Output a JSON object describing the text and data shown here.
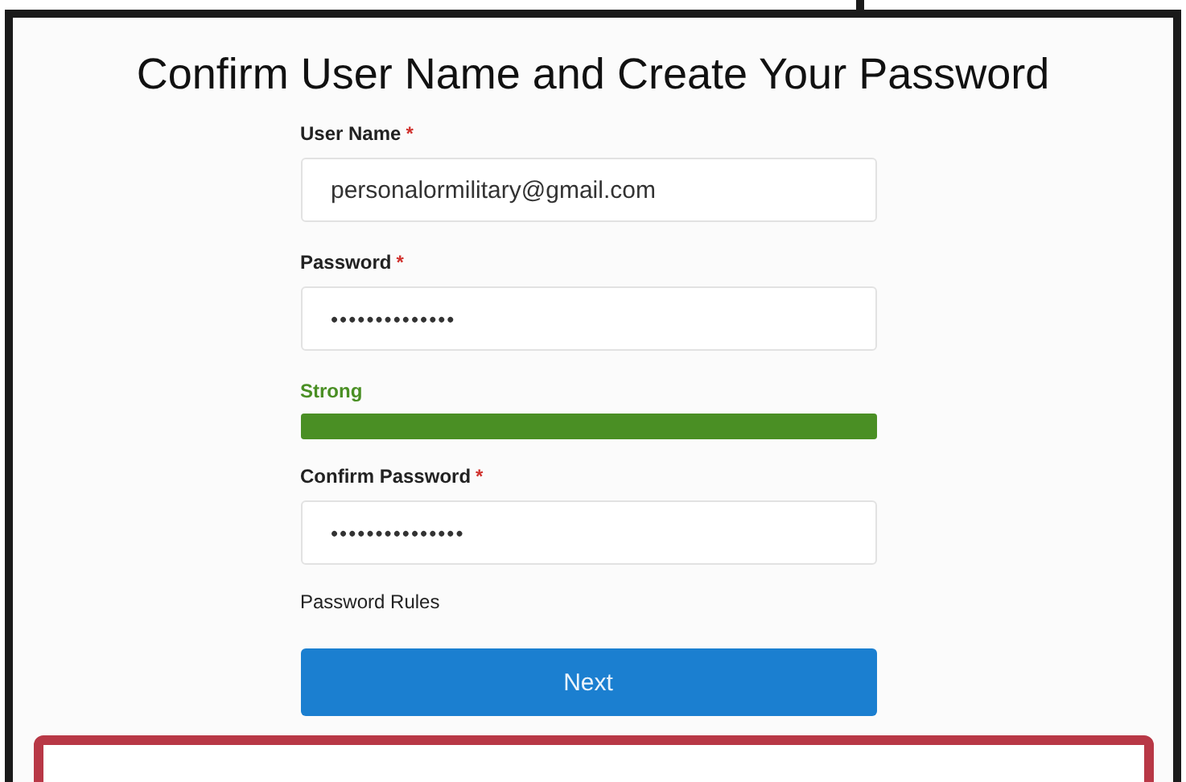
{
  "title": "Confirm User Name and Create Your Password",
  "fields": [
    {
      "kind": "text",
      "label": "User Name",
      "mark": "*",
      "value": "personalormilitary@gmail.com"
    },
    {
      "kind": "password",
      "label": "Password",
      "mark": "*",
      "value": "••••••••••••••"
    },
    {
      "kind": "strength",
      "label": "Strong",
      "level": 1,
      "color": "#4a8f24"
    },
    {
      "kind": "password",
      "label": "Confirm Password",
      "mark": "*",
      "value": "•••••••••••••••"
    }
  ],
  "rules_link": "Password Rules",
  "button": "Next"
}
